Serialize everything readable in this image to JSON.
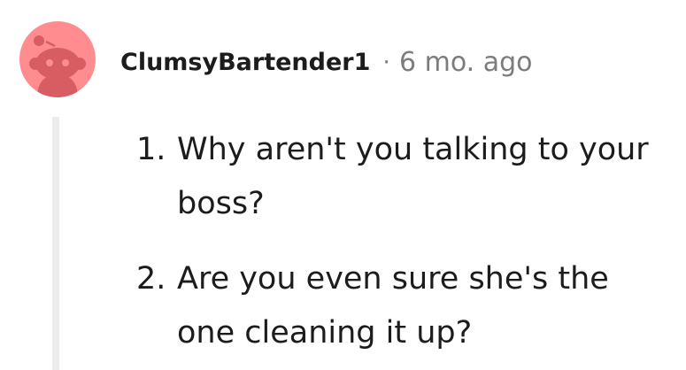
{
  "comment": {
    "author": "ClumsyBartender1",
    "separator": "·",
    "timestamp": "6 mo. ago",
    "avatar_icon": "reddit-snoo-icon",
    "avatar_color": "#ff8c8f",
    "list": [
      {
        "number": "1.",
        "text": "Why aren't you talking to your boss?"
      },
      {
        "number": "2.",
        "text": "Are you even sure she's the one cleaning it up?"
      }
    ]
  }
}
